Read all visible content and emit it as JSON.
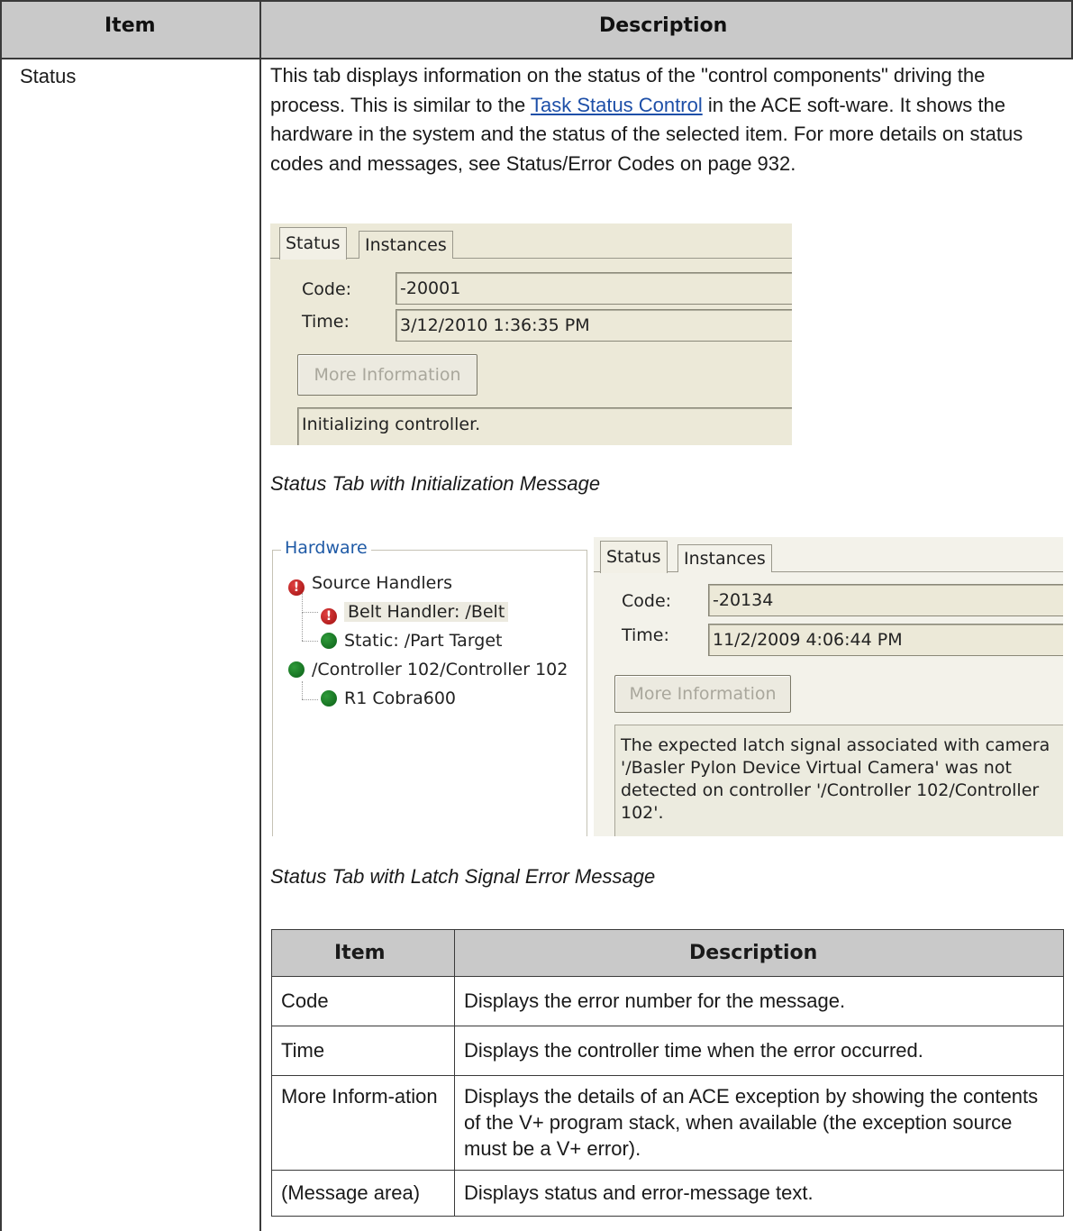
{
  "table": {
    "header_item": "Item",
    "header_description": "Description"
  },
  "row": {
    "label": "Status",
    "desc_part1": "This tab displays information on the status of the \"control components\" driving the process. This is similar to the ",
    "desc_link": "Task Status Control",
    "desc_part2": " in the ACE soft-ware. It shows the hardware in the system and the status of the selected item. For more details on status codes and messages, see Status/Error Codes on page 932."
  },
  "screenshot1": {
    "tab_status": "Status",
    "tab_instances": "Instances",
    "code_label": "Code:",
    "code_value": "-20001",
    "time_label": "Time:",
    "time_value": "3/12/2010 1:36:35 PM",
    "more_info_button": "More Information",
    "message": "Initializing controller.",
    "caption": "Status Tab with Initialization Message"
  },
  "screenshot2": {
    "hardware_title": "Hardware",
    "tree": {
      "source_handlers": "Source Handlers",
      "belt_handler": "Belt Handler: /Belt",
      "static_target": "Static: /Part Target",
      "controller": "/Controller 102/Controller 102",
      "robot": "R1 Cobra600"
    },
    "tab_status": "Status",
    "tab_instances": "Instances",
    "code_label": "Code:",
    "code_value": "-20134",
    "time_label": "Time:",
    "time_value": "11/2/2009 4:06:44 PM",
    "more_info_button": "More Information",
    "message": "The expected latch signal associated with camera '/Basler Pylon Device Virtual Camera' was not detected on controller '/Controller 102/Controller 102'.",
    "caption": "Status Tab with Latch Signal Error Message"
  },
  "inner_table": {
    "header_item": "Item",
    "header_description": "Description",
    "rows": [
      {
        "item": "Code",
        "description": "Displays the error number for the message."
      },
      {
        "item": "Time",
        "description": "Displays the controller time when the error occurred."
      },
      {
        "item": "More Inform-ation",
        "description": "Displays the details of an ACE exception by showing the contents of the V+ program stack, when available (the exception source must be a V+ error)."
      },
      {
        "item": "(Message area)",
        "description": "Displays status and error-message text."
      }
    ]
  },
  "colors": {
    "header_bg": "#c9c9c9",
    "link": "#1d4fa8",
    "status_ok": "#1a7a28",
    "status_error": "#c01818"
  },
  "icons": [
    "error-icon",
    "ok-icon"
  ]
}
